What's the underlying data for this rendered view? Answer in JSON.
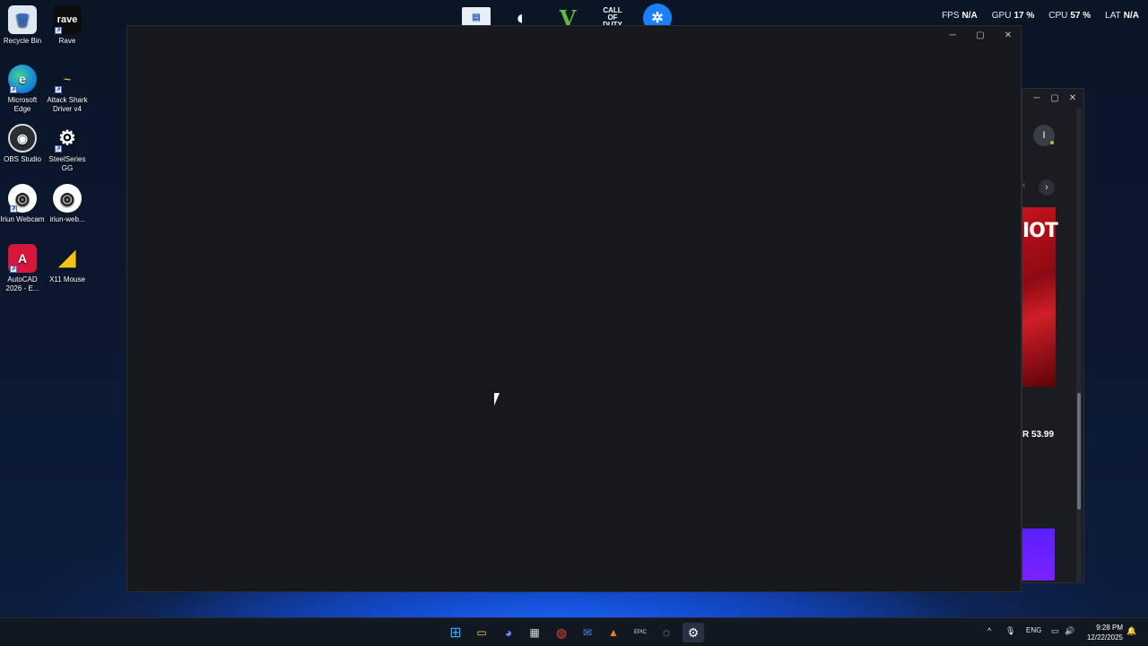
{
  "desktop_icons": [
    {
      "label": "Recycle Bin",
      "icon": "recycle-bin-icon",
      "glyph": "🗑"
    },
    {
      "label": "Rave",
      "icon": "rave-icon",
      "glyph": "rave"
    },
    {
      "label": "Microsoft Edge",
      "icon": "edge-icon",
      "glyph": "e"
    },
    {
      "label": "Attack Shark Driver v4",
      "icon": "attack-shark-icon",
      "glyph": "~"
    },
    {
      "label": "OBS Studio",
      "icon": "obs-icon",
      "glyph": "◉"
    },
    {
      "label": "SteelSeries GG",
      "icon": "steelseries-icon",
      "glyph": "⚙"
    },
    {
      "label": "Iriun Webcam",
      "icon": "iriun-icon",
      "glyph": "◎"
    },
    {
      "label": "iriun-web...",
      "icon": "iriun-web-icon",
      "glyph": "◎"
    },
    {
      "label": "AutoCAD 2026 - E...",
      "icon": "autocad-icon",
      "glyph": "A"
    },
    {
      "label": "X11 Mouse",
      "icon": "x11-mouse-icon",
      "glyph": "◢"
    }
  ],
  "top_apps": [
    {
      "name": "notepad-icon",
      "glyph": "▤"
    },
    {
      "name": "steam-icon",
      "glyph": "◐"
    },
    {
      "name": "gta-v-icon",
      "glyph": "V"
    },
    {
      "name": "call-of-duty-icon",
      "glyph": "CALL OF DUTY"
    },
    {
      "name": "battlenet-icon",
      "glyph": "✲"
    }
  ],
  "perf": {
    "fps_label": "FPS",
    "fps_value": "N/A",
    "gpu_label": "GPU",
    "gpu_value": "17 %",
    "cpu_label": "CPU",
    "cpu_value": "57 %",
    "lat_label": "LAT",
    "lat_value": "N/A"
  },
  "main_window": {
    "minimize": "─",
    "maximize": "▢",
    "close": "✕"
  },
  "bg_window": {
    "minimize": "─",
    "maximize": "▢",
    "close": "✕",
    "avatar_letter": "I",
    "banner_text": "IOT",
    "price": "R 53.99",
    "prev": "‹",
    "next": "›"
  },
  "taskbar": {
    "apps": [
      {
        "name": "start-icon",
        "glyph": "⊞"
      },
      {
        "name": "file-explorer-icon",
        "glyph": "▭"
      },
      {
        "name": "discord-icon",
        "glyph": "◕"
      },
      {
        "name": "ms-store-icon",
        "glyph": "▦"
      },
      {
        "name": "chrome-icon",
        "glyph": "◍"
      },
      {
        "name": "mail-icon",
        "glyph": "✉"
      },
      {
        "name": "app-a-icon",
        "glyph": "▲"
      },
      {
        "name": "epic-games-icon",
        "glyph": "EPIC"
      },
      {
        "name": "bg-app-icon",
        "glyph": "◌"
      },
      {
        "name": "steelseries-taskbar-icon",
        "glyph": "⚙"
      }
    ],
    "tray": {
      "chevron": "^",
      "mic": "🎙",
      "language": "ENG",
      "network": "▭",
      "volume": "🔊",
      "time": "9:28 PM",
      "date": "12/22/2025",
      "notification": "🔔"
    }
  },
  "colors": {
    "window_bg": "#16181c",
    "taskbar_bg": "#121821",
    "accent_blue": "#1d63ff"
  }
}
